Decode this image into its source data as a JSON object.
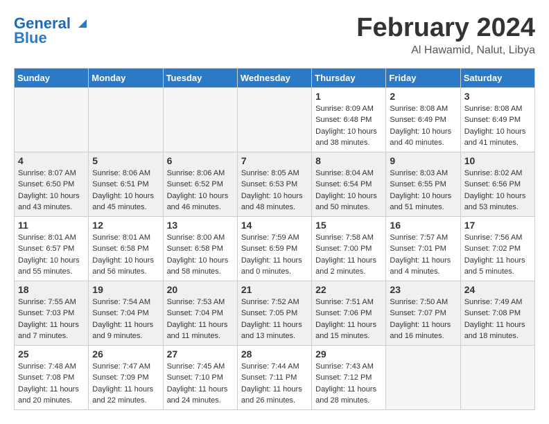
{
  "header": {
    "logo_line1": "General",
    "logo_line2": "Blue",
    "month_title": "February 2024",
    "location": "Al Hawamid, Nalut, Libya"
  },
  "days_of_week": [
    "Sunday",
    "Monday",
    "Tuesday",
    "Wednesday",
    "Thursday",
    "Friday",
    "Saturday"
  ],
  "weeks": [
    {
      "shaded": false,
      "days": [
        {
          "num": "",
          "info": ""
        },
        {
          "num": "",
          "info": ""
        },
        {
          "num": "",
          "info": ""
        },
        {
          "num": "",
          "info": ""
        },
        {
          "num": "1",
          "info": "Sunrise: 8:09 AM\nSunset: 6:48 PM\nDaylight: 10 hours\nand 38 minutes."
        },
        {
          "num": "2",
          "info": "Sunrise: 8:08 AM\nSunset: 6:49 PM\nDaylight: 10 hours\nand 40 minutes."
        },
        {
          "num": "3",
          "info": "Sunrise: 8:08 AM\nSunset: 6:49 PM\nDaylight: 10 hours\nand 41 minutes."
        }
      ]
    },
    {
      "shaded": true,
      "days": [
        {
          "num": "4",
          "info": "Sunrise: 8:07 AM\nSunset: 6:50 PM\nDaylight: 10 hours\nand 43 minutes."
        },
        {
          "num": "5",
          "info": "Sunrise: 8:06 AM\nSunset: 6:51 PM\nDaylight: 10 hours\nand 45 minutes."
        },
        {
          "num": "6",
          "info": "Sunrise: 8:06 AM\nSunset: 6:52 PM\nDaylight: 10 hours\nand 46 minutes."
        },
        {
          "num": "7",
          "info": "Sunrise: 8:05 AM\nSunset: 6:53 PM\nDaylight: 10 hours\nand 48 minutes."
        },
        {
          "num": "8",
          "info": "Sunrise: 8:04 AM\nSunset: 6:54 PM\nDaylight: 10 hours\nand 50 minutes."
        },
        {
          "num": "9",
          "info": "Sunrise: 8:03 AM\nSunset: 6:55 PM\nDaylight: 10 hours\nand 51 minutes."
        },
        {
          "num": "10",
          "info": "Sunrise: 8:02 AM\nSunset: 6:56 PM\nDaylight: 10 hours\nand 53 minutes."
        }
      ]
    },
    {
      "shaded": false,
      "days": [
        {
          "num": "11",
          "info": "Sunrise: 8:01 AM\nSunset: 6:57 PM\nDaylight: 10 hours\nand 55 minutes."
        },
        {
          "num": "12",
          "info": "Sunrise: 8:01 AM\nSunset: 6:58 PM\nDaylight: 10 hours\nand 56 minutes."
        },
        {
          "num": "13",
          "info": "Sunrise: 8:00 AM\nSunset: 6:58 PM\nDaylight: 10 hours\nand 58 minutes."
        },
        {
          "num": "14",
          "info": "Sunrise: 7:59 AM\nSunset: 6:59 PM\nDaylight: 11 hours\nand 0 minutes."
        },
        {
          "num": "15",
          "info": "Sunrise: 7:58 AM\nSunset: 7:00 PM\nDaylight: 11 hours\nand 2 minutes."
        },
        {
          "num": "16",
          "info": "Sunrise: 7:57 AM\nSunset: 7:01 PM\nDaylight: 11 hours\nand 4 minutes."
        },
        {
          "num": "17",
          "info": "Sunrise: 7:56 AM\nSunset: 7:02 PM\nDaylight: 11 hours\nand 5 minutes."
        }
      ]
    },
    {
      "shaded": true,
      "days": [
        {
          "num": "18",
          "info": "Sunrise: 7:55 AM\nSunset: 7:03 PM\nDaylight: 11 hours\nand 7 minutes."
        },
        {
          "num": "19",
          "info": "Sunrise: 7:54 AM\nSunset: 7:04 PM\nDaylight: 11 hours\nand 9 minutes."
        },
        {
          "num": "20",
          "info": "Sunrise: 7:53 AM\nSunset: 7:04 PM\nDaylight: 11 hours\nand 11 minutes."
        },
        {
          "num": "21",
          "info": "Sunrise: 7:52 AM\nSunset: 7:05 PM\nDaylight: 11 hours\nand 13 minutes."
        },
        {
          "num": "22",
          "info": "Sunrise: 7:51 AM\nSunset: 7:06 PM\nDaylight: 11 hours\nand 15 minutes."
        },
        {
          "num": "23",
          "info": "Sunrise: 7:50 AM\nSunset: 7:07 PM\nDaylight: 11 hours\nand 16 minutes."
        },
        {
          "num": "24",
          "info": "Sunrise: 7:49 AM\nSunset: 7:08 PM\nDaylight: 11 hours\nand 18 minutes."
        }
      ]
    },
    {
      "shaded": false,
      "days": [
        {
          "num": "25",
          "info": "Sunrise: 7:48 AM\nSunset: 7:08 PM\nDaylight: 11 hours\nand 20 minutes."
        },
        {
          "num": "26",
          "info": "Sunrise: 7:47 AM\nSunset: 7:09 PM\nDaylight: 11 hours\nand 22 minutes."
        },
        {
          "num": "27",
          "info": "Sunrise: 7:45 AM\nSunset: 7:10 PM\nDaylight: 11 hours\nand 24 minutes."
        },
        {
          "num": "28",
          "info": "Sunrise: 7:44 AM\nSunset: 7:11 PM\nDaylight: 11 hours\nand 26 minutes."
        },
        {
          "num": "29",
          "info": "Sunrise: 7:43 AM\nSunset: 7:12 PM\nDaylight: 11 hours\nand 28 minutes."
        },
        {
          "num": "",
          "info": ""
        },
        {
          "num": "",
          "info": ""
        }
      ]
    }
  ]
}
